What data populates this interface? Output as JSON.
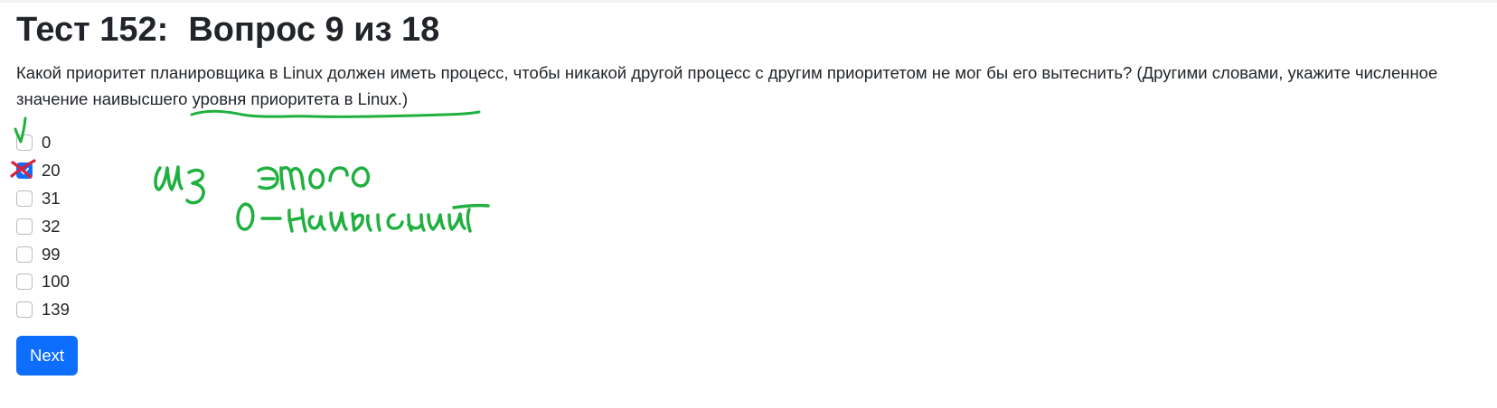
{
  "header": {
    "test_label": "Тест 152:",
    "progress_label": "Вопрос 9 из 18"
  },
  "question": {
    "text": "Какой приоритет планировщика в Linux должен иметь процесс, чтобы никакой другой процесс с другим приоритетом не мог бы его вытеснить? (Другими словами, укажите численное значение наивысшего уровня приоритета в Linux.)"
  },
  "options": [
    {
      "label": "0",
      "checked": false
    },
    {
      "label": "20",
      "checked": true
    },
    {
      "label": "31",
      "checked": false
    },
    {
      "label": "32",
      "checked": false
    },
    {
      "label": "99",
      "checked": false
    },
    {
      "label": "100",
      "checked": false
    },
    {
      "label": "139",
      "checked": false
    }
  ],
  "actions": {
    "next_label": "Next"
  },
  "annotations": {
    "ink_color": "#1fb03f",
    "wrong_mark_color": "#d8203a",
    "note": "из этого 0-наивысший"
  },
  "colors": {
    "accent": "#0d6efd",
    "text": "#212529"
  }
}
